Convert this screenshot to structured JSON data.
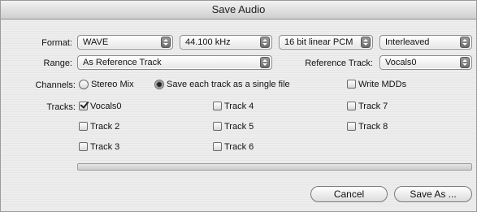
{
  "window": {
    "title": "Save Audio"
  },
  "format": {
    "label": "Format:",
    "file_type": "WAVE",
    "sample_rate": "44.100 kHz",
    "bit_depth": "16 bit linear PCM",
    "channel_layout": "Interleaved"
  },
  "range": {
    "label": "Range:",
    "value": "As Reference Track",
    "reference_label": "Reference Track:",
    "reference_value": "Vocals0"
  },
  "channels": {
    "label": "Channels:",
    "options": [
      {
        "label": "Stereo Mix",
        "selected": false
      },
      {
        "label": "Save each track as a single file",
        "selected": true
      }
    ],
    "write_mdds_label": "Write MDDs",
    "write_mdds_checked": false
  },
  "tracks": {
    "label": "Tracks:",
    "items": [
      {
        "label": "Vocals0",
        "checked": true
      },
      {
        "label": "Track 2",
        "checked": false
      },
      {
        "label": "Track 3",
        "checked": false
      },
      {
        "label": "Track 4",
        "checked": false
      },
      {
        "label": "Track 5",
        "checked": false
      },
      {
        "label": "Track 6",
        "checked": false
      },
      {
        "label": "Track 7",
        "checked": false
      },
      {
        "label": "Track 8",
        "checked": false
      }
    ]
  },
  "progress": {
    "value": 0
  },
  "buttons": {
    "cancel": "Cancel",
    "save_as": "Save As ..."
  }
}
